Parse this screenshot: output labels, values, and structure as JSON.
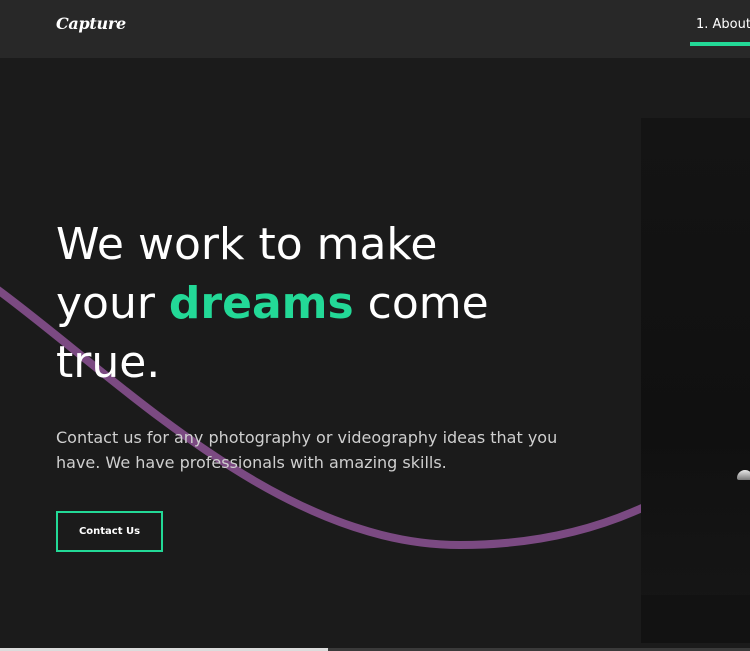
{
  "header": {
    "logo": "Capture",
    "nav": [
      {
        "label": "1. About"
      }
    ]
  },
  "hero": {
    "title_line1": "We work to make",
    "title_pre": "your ",
    "title_accent": "dreams",
    "title_post": " come",
    "title_line3": "true.",
    "description": "Contact us for any photography or videography ideas that you have. We have professionals with amazing skills.",
    "cta_label": "Contact Us"
  },
  "colors": {
    "background": "#1b1b1b",
    "header": "#282828",
    "accent": "#23d997",
    "wave": "#7b4a82"
  }
}
